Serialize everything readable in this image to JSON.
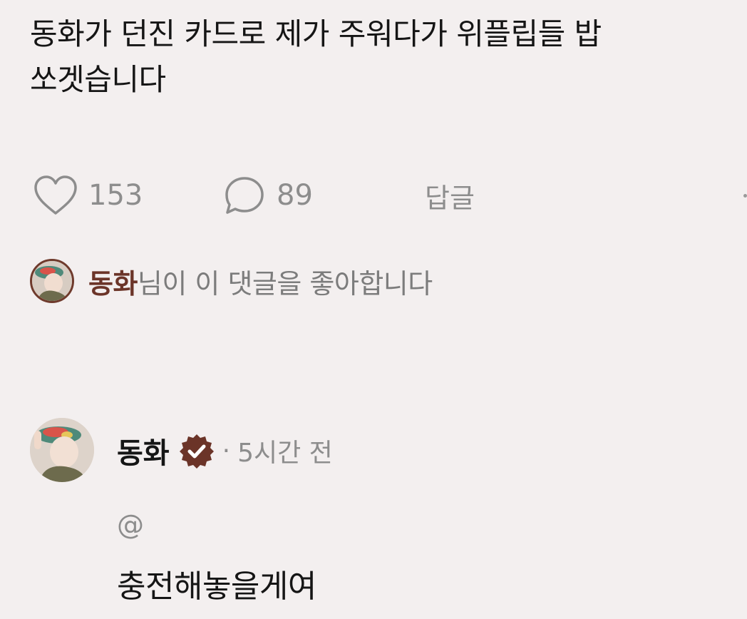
{
  "post": {
    "text": "동화가 던진 카드로 제가 주워다가 위플립들 밥\n쏘겟습니다"
  },
  "actions": {
    "like_count": "153",
    "comment_count": "89",
    "reply_label": "답글"
  },
  "liked_by": {
    "name": "동화",
    "suffix": "님이 이 댓글을 좋아합니다"
  },
  "comment": {
    "author": "동화",
    "separator": "·",
    "time": "5시간 전",
    "mention": "@",
    "body": "충전해놓을게여"
  },
  "colors": {
    "background": "#f3efef",
    "accent_brown": "#6b3428",
    "muted_text": "#8d8d8d"
  },
  "icons": {
    "like": "heart-outline-icon",
    "comment": "speech-bubble-icon",
    "verified": "verified-badge-icon",
    "more": "more-dot-icon"
  }
}
